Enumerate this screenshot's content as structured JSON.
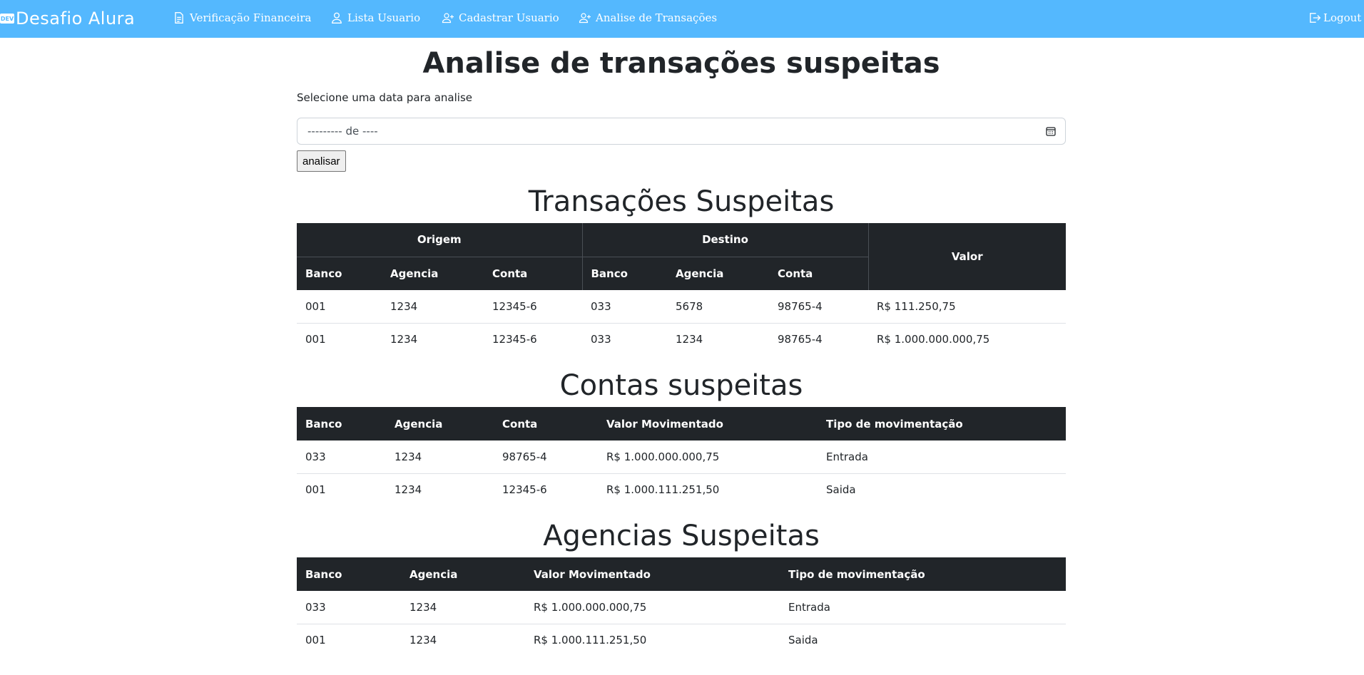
{
  "navbar": {
    "brand_logo": "DEV",
    "brand": "Desafio Alura",
    "links": [
      {
        "label": "Verificação Financeira",
        "icon": "document-icon"
      },
      {
        "label": "Lista Usuario",
        "icon": "person-icon"
      },
      {
        "label": "Cadastrar Usuario",
        "icon": "person-add-icon"
      },
      {
        "label": "Analise de Transações",
        "icon": "person-add-icon"
      }
    ],
    "logout": "Logout",
    "color": "#54b8fe"
  },
  "page": {
    "title": "Analise de transações suspeitas",
    "date_label": "Selecione uma data para analise",
    "date_value": "--------- de ----",
    "analyze_button": "analisar"
  },
  "transacoes": {
    "title": "Transações Suspeitas",
    "group_origem": "Origem",
    "group_destino": "Destino",
    "valor_header": "Valor",
    "sub_headers": [
      "Banco",
      "Agencia",
      "Conta",
      "Banco",
      "Agencia",
      "Conta"
    ],
    "rows": [
      [
        "001",
        "1234",
        "12345-6",
        "033",
        "5678",
        "98765-4",
        "R$ 111.250,75"
      ],
      [
        "001",
        "1234",
        "12345-6",
        "033",
        "1234",
        "98765-4",
        "R$ 1.000.000.000,75"
      ]
    ]
  },
  "contas": {
    "title": "Contas suspeitas",
    "headers": [
      "Banco",
      "Agencia",
      "Conta",
      "Valor Movimentado",
      "Tipo de movimentação"
    ],
    "rows": [
      [
        "033",
        "1234",
        "98765-4",
        "R$ 1.000.000.000,75",
        "Entrada"
      ],
      [
        "001",
        "1234",
        "12345-6",
        "R$ 1.000.111.251,50",
        "Saida"
      ]
    ]
  },
  "agencias": {
    "title": "Agencias Suspeitas",
    "headers": [
      "Banco",
      "Agencia",
      "Valor Movimentado",
      "Tipo de movimentação"
    ],
    "rows": [
      [
        "033",
        "1234",
        "R$ 1.000.000.000,75",
        "Entrada"
      ],
      [
        "001",
        "1234",
        "R$ 1.000.111.251,50",
        "Saida"
      ]
    ]
  }
}
